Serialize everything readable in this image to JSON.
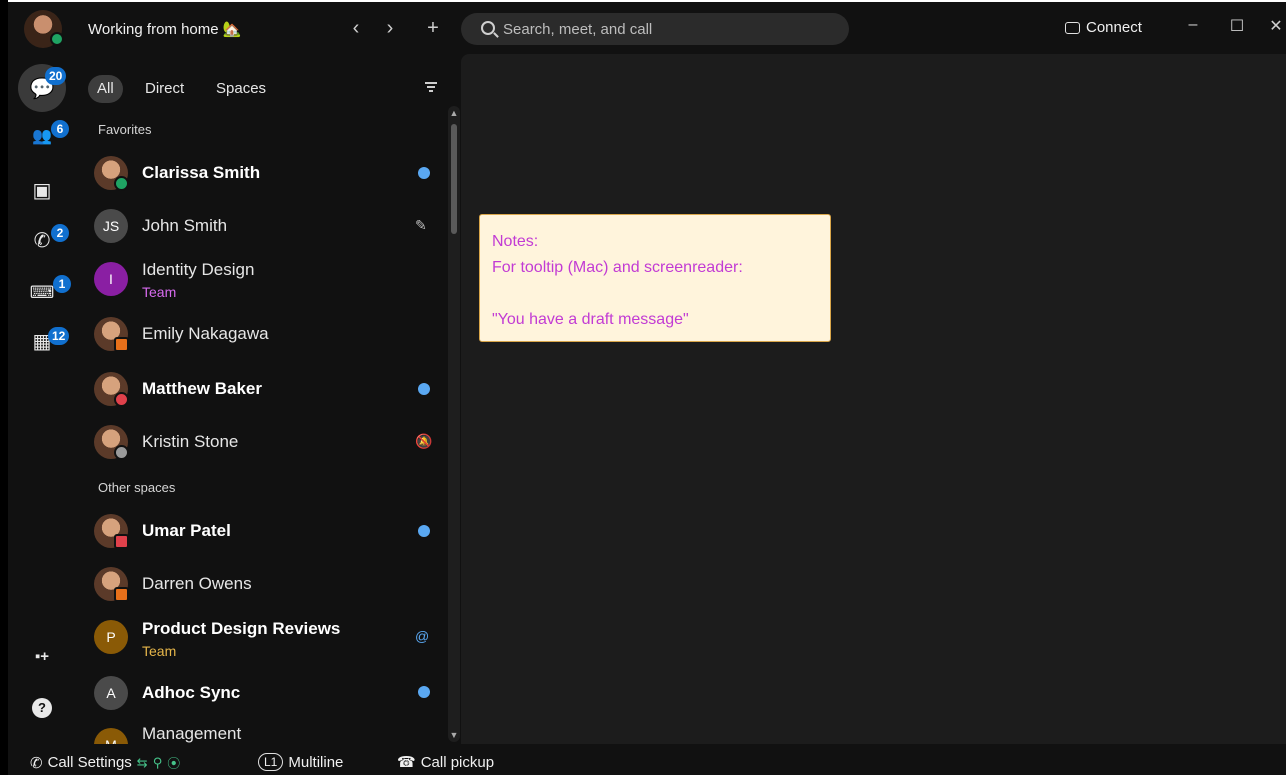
{
  "topbar": {
    "status_text": "Working from home 🏡",
    "back_glyph": "‹",
    "forward_glyph": "›",
    "new_glyph": "+",
    "search_placeholder": "Search, meet, and call",
    "connect_label": "Connect",
    "minimize_glyph": "–",
    "maximize_glyph": "☐",
    "close_glyph": "✕"
  },
  "rail": {
    "items": [
      {
        "icon": "messaging-icon",
        "glyph": "💬",
        "badge": "20"
      },
      {
        "icon": "teams-icon",
        "glyph": "👥",
        "badge": "6"
      },
      {
        "icon": "contacts-icon",
        "glyph": "▣",
        "badge": ""
      },
      {
        "icon": "calling-icon",
        "glyph": "✆",
        "badge": "2"
      },
      {
        "icon": "voicemail-icon",
        "glyph": "⌨",
        "badge": "1"
      },
      {
        "icon": "meetings-icon",
        "glyph": "▦",
        "badge": "12"
      }
    ],
    "apps_glyph": "▪+",
    "help_glyph": "?"
  },
  "filters": {
    "all": "All",
    "direct": "Direct",
    "spaces": "Spaces"
  },
  "sections": {
    "favorites": "Favorites",
    "other": "Other spaces"
  },
  "contacts": [
    {
      "name": "Clarissa Smith",
      "initials": "",
      "sub": "",
      "bold": true,
      "indicator": "unread",
      "status_color": "#1fa463"
    },
    {
      "name": "John Smith",
      "initials": "JS",
      "sub": "",
      "bold": false,
      "indicator": "draft",
      "status_color": ""
    },
    {
      "name": "Identity Design",
      "initials": "I",
      "sub": "Team",
      "bold": false,
      "indicator": "",
      "status_color": ""
    },
    {
      "name": "Emily Nakagawa",
      "initials": "",
      "sub": "",
      "bold": false,
      "indicator": "",
      "status_color": "#e8701a"
    },
    {
      "name": "Matthew Baker",
      "initials": "",
      "sub": "",
      "bold": true,
      "indicator": "unread",
      "status_color": "#e0414b"
    },
    {
      "name": "Kristin Stone",
      "initials": "",
      "sub": "",
      "bold": false,
      "indicator": "muted",
      "status_color": "#bdbdbd"
    },
    {
      "name": "Umar Patel",
      "initials": "",
      "sub": "",
      "bold": true,
      "indicator": "unread",
      "status_color": "#e0414b"
    },
    {
      "name": "Darren Owens",
      "initials": "",
      "sub": "",
      "bold": false,
      "indicator": "",
      "status_color": "#e8701a"
    },
    {
      "name": "Product Design Reviews",
      "initials": "P",
      "sub": "Team",
      "bold": true,
      "indicator": "mention",
      "status_color": ""
    },
    {
      "name": "Adhoc Sync",
      "initials": "A",
      "sub": "",
      "bold": true,
      "indicator": "unread",
      "status_color": ""
    },
    {
      "name": "Management",
      "initials": "M",
      "sub": "",
      "bold": false,
      "indicator": "",
      "status_color": ""
    }
  ],
  "row_icons": {
    "draft": "✎",
    "muted": "🔕",
    "mention": "@"
  },
  "note": {
    "line1": "Notes:",
    "line2": "For tooltip (Mac) and screenreader:",
    "line3": "\"You have a draft message\""
  },
  "bottombar": {
    "call_settings": "Call Settings",
    "multiline_badge": "L1",
    "multiline": "Multiline",
    "call_pickup": "Call pickup"
  },
  "colors": {
    "accent": "#1170cf",
    "unread_dot": "#5aa8f2",
    "note_bg": "#fff4dc",
    "note_text": "#c23bd4",
    "team_purple": "#d86bf0",
    "team_gold": "#e6b64a"
  }
}
